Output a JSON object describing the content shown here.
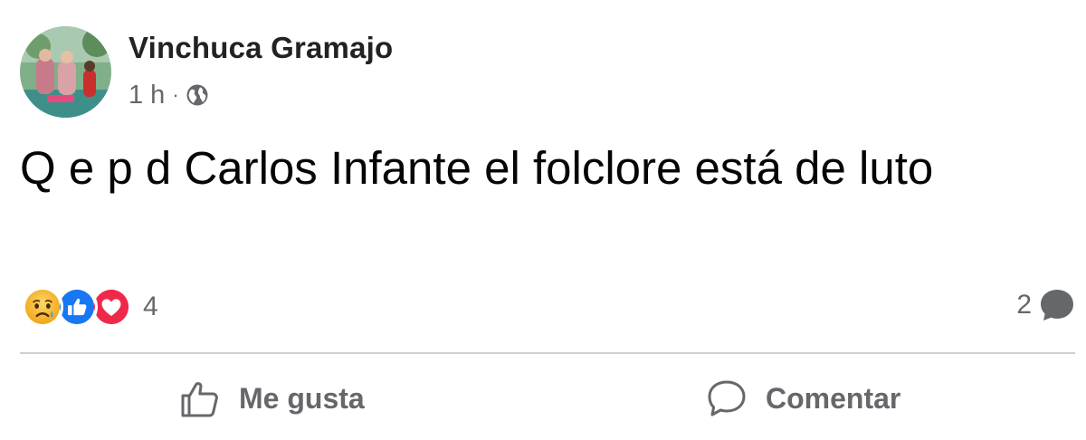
{
  "post": {
    "author": "Vinchuca Gramajo",
    "timestamp": "1 h",
    "separator": "·",
    "privacy_icon": "globe-icon",
    "text": "Q e p d Carlos Infante el folclore está de luto"
  },
  "reactions": {
    "types": [
      "sad",
      "like",
      "love"
    ],
    "count": "4"
  },
  "comments": {
    "count": "2",
    "icon": "comment-bubble-icon"
  },
  "actions": {
    "like_label": "Me gusta",
    "like_icon": "thumbs-up-icon",
    "comment_label": "Comentar",
    "comment_icon": "speech-bubble-icon"
  },
  "colors": {
    "like_blue": "#1877f2",
    "love_red": "#f02849",
    "sad_yellow": "#f7b125",
    "secondary_text": "#65676b",
    "divider": "#ced0d4"
  }
}
